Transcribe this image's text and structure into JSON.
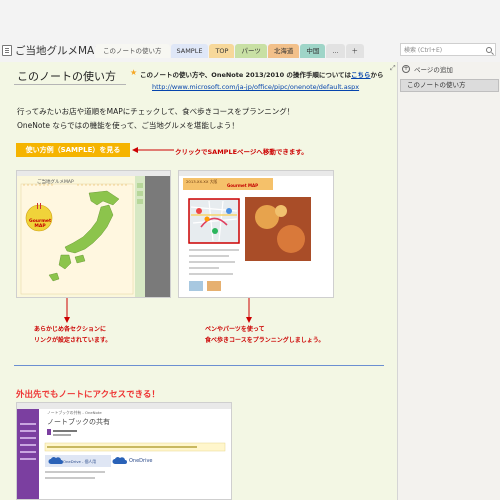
{
  "notebook": {
    "title": "ご当地グルメMAP"
  },
  "tabs": [
    {
      "label": "このノートの使い方",
      "color": "#f7f7f2",
      "active": true
    },
    {
      "label": "SAMPLE",
      "color": "#dfe7f7",
      "active": false
    },
    {
      "label": "TOP",
      "color": "#f7d89a",
      "active": false
    },
    {
      "label": "パーツ",
      "color": "#c8e0a4",
      "active": false
    },
    {
      "label": "北海道",
      "color": "#f2c08a",
      "active": false
    },
    {
      "label": "中国",
      "color": "#9fd5c8",
      "active": false
    },
    {
      "label": "...",
      "color": "#e2e2e2",
      "active": false
    },
    {
      "label": "＋",
      "color": "#e2e2e2",
      "active": false
    }
  ],
  "search": {
    "placeholder": "検索 (Ctrl+E)"
  },
  "page": {
    "title": "このノートの使い方",
    "note_line1_pre": "このノートの使い方や、OneNote 2013/2010 の操作手順については",
    "note_line1_link": "こちら",
    "note_line1_post": "から",
    "note_url": "http://www.microsoft.com/ja-jp/office/pipc/onenote/default.aspx",
    "intro1": "行ってみたいお店や道順をMAPにチェックして、食べ歩きコースをプランニング！",
    "intro2": "OneNote ならではの機能を使って、ご当地グルメを堪能しよう！",
    "sample_button": "使い方例（SAMPLE）を見る",
    "annot_click": "クリックでSAMPLEページへ移動できます。",
    "annot_left_1": "あらかじめ各セクションに",
    "annot_left_2": "リンクが設定されています。",
    "annot_right_1": "ペンやパーツを使って",
    "annot_right_2": "食べ歩きコースをプランニングしましょう。",
    "section2_title": "外出先でもノートにアクセスできる！"
  },
  "shot1": {
    "title": "ご当地グルメMAP",
    "logo_l1": "Gourmet",
    "logo_l2": "MAP"
  },
  "shot2": {
    "header": "2013.XX.XX 大阪",
    "logo": "Gourmet MAP"
  },
  "shot3": {
    "heading": "ノートブックの共有",
    "item1": "OneDrive - 個人用",
    "item2": "OneDrive"
  },
  "rightpanel": {
    "add_page": "ページの追加",
    "page_item": "このノートの使い方"
  },
  "colors": {
    "accent_red": "#cc0000",
    "button_orange": "#f5b400",
    "link_blue": "#0645ad",
    "page_bg": "#f3f7e4"
  }
}
